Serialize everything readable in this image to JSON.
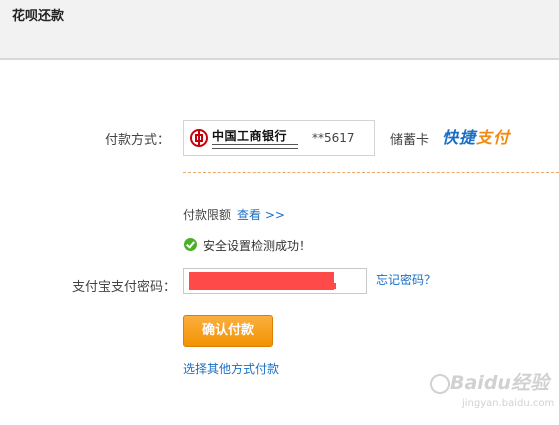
{
  "header": {
    "title": "花呗还款"
  },
  "payment": {
    "method_label": "付款方式：",
    "bank_name": "中国工商银行",
    "card_number": "**5617",
    "card_type": "储蓄卡",
    "quickpay_main": "快捷",
    "quickpay_accent": "支付"
  },
  "limit": {
    "label": "付款限额",
    "link": "查看 >>"
  },
  "security": {
    "message": "安全设置检测成功！"
  },
  "password": {
    "label": "支付宝支付密码：",
    "forgot_link": "忘记密码？"
  },
  "actions": {
    "confirm": "确认付款",
    "other_method": "选择其他方式付款"
  },
  "watermark": {
    "main": "Baidu经验",
    "sub": "jingyan.baidu.com"
  },
  "colors": {
    "link": "#1a6fc4",
    "button": "#f39200",
    "success": "#4caf2a",
    "redaction": "#ff4a4a"
  },
  "icons": {
    "bank_logo": "icbc-logo-icon",
    "success": "check-circle-icon"
  }
}
